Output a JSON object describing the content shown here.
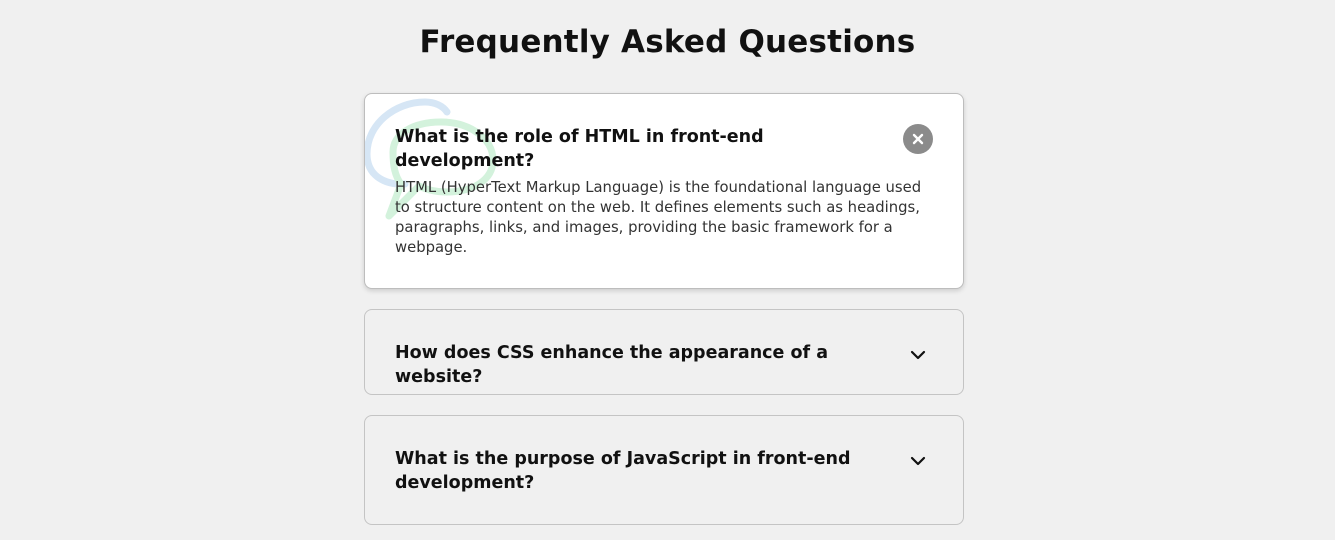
{
  "page": {
    "title": "Frequently Asked Questions"
  },
  "faqs": [
    {
      "question": "What is the role of HTML in front-end development?",
      "answer": "HTML (HyperText Markup Language) is the foundational language used to structure content on the web. It defines elements such as headings, paragraphs, links, and images, providing the basic framework for a webpage.",
      "expanded": true,
      "toggle_icon": "close-icon"
    },
    {
      "question": "How does CSS enhance the appearance of a website?",
      "answer": "",
      "expanded": false,
      "toggle_icon": "chevron-down-icon"
    },
    {
      "question": "What is the purpose of JavaScript in front-end development?",
      "answer": "",
      "expanded": false,
      "toggle_icon": "chevron-down-icon"
    }
  ],
  "colors": {
    "background": "#f0f0f0",
    "active_card": "#ffffff",
    "border": "#c4c4c4",
    "close_button": "#8b8b8b",
    "bubble_blue": "#d6e6f5",
    "bubble_green": "#d3f2dc"
  }
}
